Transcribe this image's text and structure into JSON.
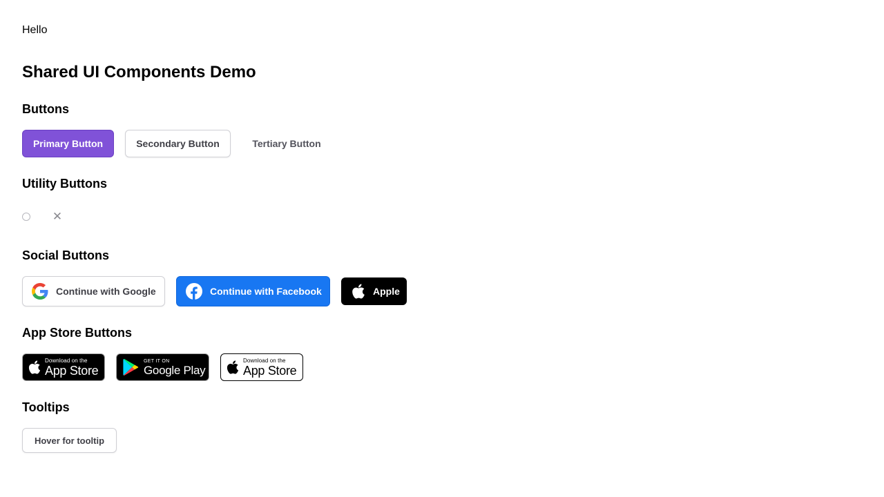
{
  "greeting": "Hello",
  "page_title": "Shared UI Components Demo",
  "sections": {
    "buttons": {
      "title": "Buttons",
      "primary_label": "Primary Button",
      "secondary_label": "Secondary Button",
      "tertiary_label": "Tertiary Button"
    },
    "utility": {
      "title": "Utility Buttons",
      "close_glyph": "✕"
    },
    "social": {
      "title": "Social Buttons",
      "google_label": "Continue with Google",
      "facebook_label": "Continue with Facebook",
      "apple_label": "Apple"
    },
    "app_store": {
      "title": "App Store Buttons",
      "apple_dark": {
        "small": "Download on the",
        "large": "App Store"
      },
      "google_play": {
        "small": "GET IT ON",
        "large": "Google Play"
      },
      "apple_light": {
        "small": "Download on the",
        "large": "App Store"
      }
    },
    "tooltips": {
      "title": "Tooltips",
      "button_label": "Hover for tooltip"
    }
  },
  "colors": {
    "primary": "#8052d8",
    "facebook": "#1877f2",
    "apple": "#000000"
  },
  "icons": [
    "radio-icon",
    "close-icon",
    "google-icon",
    "facebook-icon",
    "apple-icon",
    "google-play-icon"
  ]
}
